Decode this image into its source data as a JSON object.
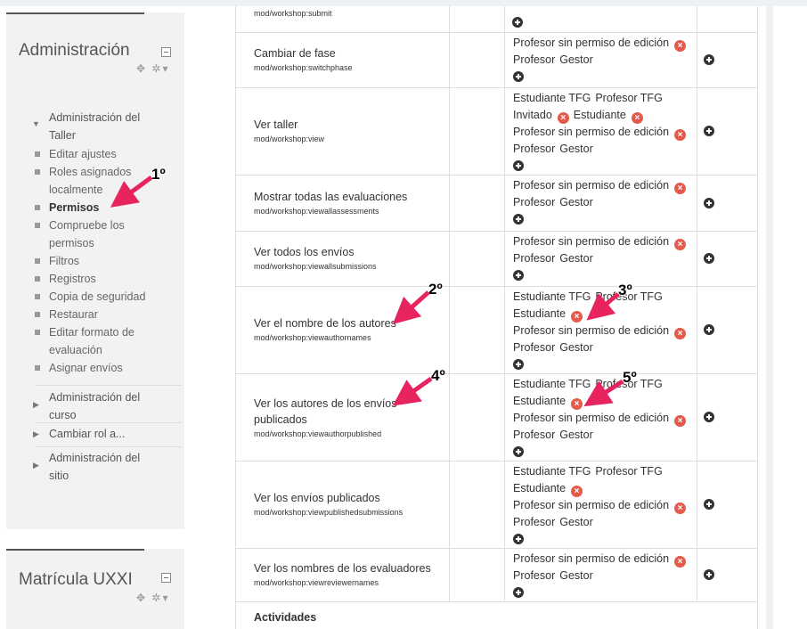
{
  "sidebar": {
    "admin_block": {
      "title": "Administración",
      "controls": "✥ ✲▾",
      "workshop_admin": "Administración del Taller",
      "items": [
        {
          "label": "Editar ajustes"
        },
        {
          "label": "Roles asignados localmente"
        },
        {
          "label": "Permisos"
        },
        {
          "label": "Compruebe los permisos"
        },
        {
          "label": "Filtros"
        },
        {
          "label": "Registros"
        },
        {
          "label": "Copia de seguridad"
        },
        {
          "label": "Restaurar"
        },
        {
          "label": "Editar formato de evaluación"
        },
        {
          "label": "Asignar envíos"
        }
      ],
      "course_admin": "Administración del curso",
      "switch_role": "Cambiar rol a...",
      "site_admin": "Administración del sitio"
    },
    "matricula_block": {
      "title": "Matrícula UXXI",
      "controls": "✥ ✲▾"
    }
  },
  "table": {
    "top_partial_id": "mod/workshop:submit",
    "rows": [
      {
        "name": "Cambiar de fase",
        "id": "mod/workshop:switchphase",
        "roles_html": "Profesor sin permiso de edición|X\nProfesor  Gestor"
      },
      {
        "name": "Ver taller",
        "id": "mod/workshop:view",
        "roles_html": "Estudiante TFG  Profesor TFG\nInvitado|X  Estudiante|X\nProfesor sin permiso de edición|X\nProfesor  Gestor"
      },
      {
        "name": "Mostrar todas las evaluaciones",
        "id": "mod/workshop:viewallassessments",
        "roles_html": "Profesor sin permiso de edición|X\nProfesor  Gestor"
      },
      {
        "name": "Ver todos los envíos",
        "id": "mod/workshop:viewallsubmissions",
        "roles_html": "Profesor sin permiso de edición|X\nProfesor  Gestor"
      },
      {
        "name": "Ver el nombre de los autores",
        "id": "mod/workshop:viewauthornames",
        "roles_html": "Estudiante TFG  Profesor TFG\nEstudiante|X\nProfesor sin permiso de edición|X\nProfesor  Gestor"
      },
      {
        "name": "Ver los autores de los envíos publicados",
        "id": "mod/workshop:viewauthorpublished",
        "roles_html": "Estudiante TFG  Profesor TFG\nEstudiante|X\nProfesor sin permiso de edición|X\nProfesor  Gestor"
      },
      {
        "name": "Ver los envíos publicados",
        "id": "mod/workshop:viewpublishedsubmissions",
        "roles_html": "Estudiante TFG  Profesor TFG\nEstudiante|X\nProfesor sin permiso de edición|X\nProfesor  Gestor"
      },
      {
        "name": "Ver los nombres de los evaluadores",
        "id": "mod/workshop:viewreviewernames",
        "roles_html": "Profesor sin permiso de edición|X\nProfesor  Gestor"
      }
    ],
    "section_heading": "Actividades"
  },
  "annotations": [
    "1º",
    "2º",
    "3º",
    "4º",
    "5º"
  ],
  "colors": {
    "arrow": "#e8245f",
    "remove_icon": "#e35b4c"
  }
}
